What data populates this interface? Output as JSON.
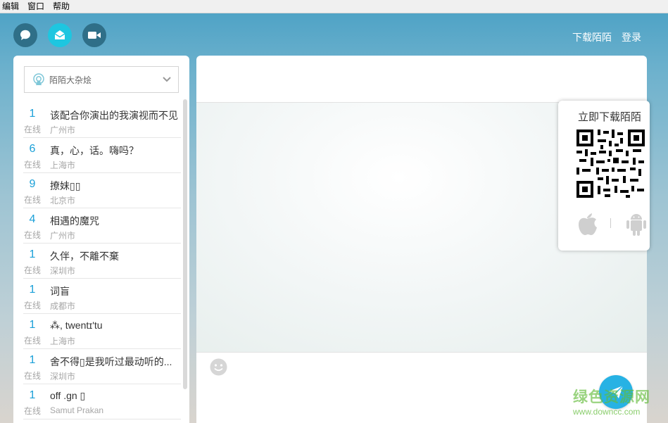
{
  "menubar": {
    "items": [
      "编辑",
      "窗口",
      "帮助"
    ]
  },
  "top": {
    "icons": [
      "chat-bubble-icon",
      "mail-open-icon",
      "video-camera-icon"
    ],
    "active_icon": 1,
    "links": {
      "download": "下载陌陌",
      "login": "登录"
    }
  },
  "channel": {
    "icon": "broadcast-icon",
    "label": "陌陌大杂烩",
    "dropdown_icon": "chevron-down-icon"
  },
  "rooms": [
    {
      "count": "1",
      "status": "在线",
      "title": "该配合你演出的我演视而不见",
      "city": "广州市"
    },
    {
      "count": "6",
      "status": "在线",
      "title": "真，心，话。嗨吗？",
      "city": "上海市"
    },
    {
      "count": "9",
      "status": "在线",
      "title": "撩妹▯▯",
      "city": "北京市"
    },
    {
      "count": "4",
      "status": "在线",
      "title": "相遇的魔咒",
      "city": "广州市"
    },
    {
      "count": "1",
      "status": "在线",
      "title": "久伴，不離不棄",
      "city": "深圳市"
    },
    {
      "count": "1",
      "status": "在线",
      "title": "词盲",
      "city": "成都市"
    },
    {
      "count": "1",
      "status": "在线",
      "title": "⁂, twentɪ'tu",
      "city": "上海市"
    },
    {
      "count": "1",
      "status": "在线",
      "title": "舍不得▯是我听过最动听的...",
      "city": "深圳市"
    },
    {
      "count": "1",
      "status": "在线",
      "title": "off .gn ▯",
      "city": "Samut Prakan"
    }
  ],
  "qr": {
    "title": "立即下载陌陌",
    "apple_icon": "apple-icon",
    "android_icon": "android-icon"
  },
  "composer": {
    "emoji_icon": "smiley-icon",
    "send_icon": "paper-plane-icon"
  },
  "watermark": {
    "line1": "绿色资源网",
    "line2": "www.downcc.com"
  },
  "colors": {
    "accent": "#1aa0d8",
    "active_icon": "#1ec6e0",
    "send_button": "#27b2e4"
  }
}
